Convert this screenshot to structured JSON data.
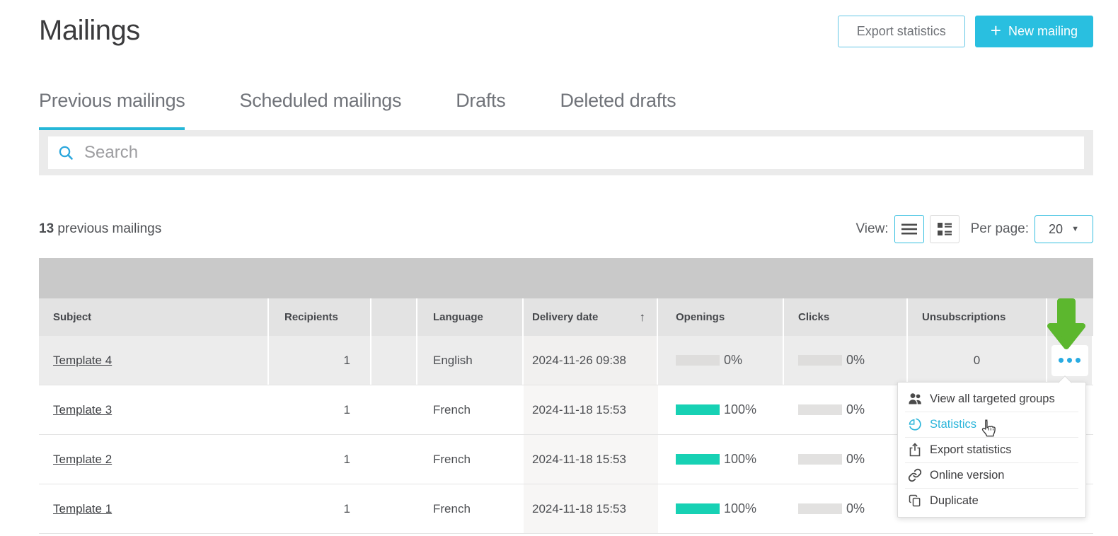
{
  "colors": {
    "accent_cyan": "#29bfe0",
    "tab_underline": "#26b7d8",
    "teal_bar": "#17d1b4",
    "green_arrow": "#5cb72e",
    "icon_blue": "#2ba7dd",
    "menu_hover_blue": "#2cb5da"
  },
  "header": {
    "title": "Mailings",
    "export_button": "Export statistics",
    "new_mailing_plus": "+",
    "new_mailing_button": "New mailing"
  },
  "tabs": [
    {
      "label": "Previous mailings"
    },
    {
      "label": "Scheduled mailings"
    },
    {
      "label": "Drafts"
    },
    {
      "label": "Deleted drafts"
    }
  ],
  "search": {
    "placeholder": "Search"
  },
  "summary": {
    "count": "13",
    "label": "previous mailings"
  },
  "view_controls": {
    "view_label": "View:",
    "per_page_label": "Per page:",
    "per_page_value": "20",
    "per_page_arrow": "▼"
  },
  "table": {
    "columns": {
      "subject": "Subject",
      "recipients": "Recipients",
      "language": "Language",
      "delivery_date": "Delivery date",
      "sort_arrow": "↑",
      "openings": "Openings",
      "clicks": "Clicks",
      "unsubscriptions": "Unsubscriptions"
    },
    "rows": [
      {
        "subject": "Template 4",
        "recipients": "1",
        "language": "English",
        "delivery_date": "2024-11-26 09:38",
        "openings_pct": 0,
        "openings_label": "0%",
        "clicks_pct": 0,
        "clicks_label": "0%",
        "unsubscriptions": "0"
      },
      {
        "subject": "Template 3",
        "recipients": "1",
        "language": "French",
        "delivery_date": "2024-11-18 15:53",
        "openings_pct": 100,
        "openings_label": "100%",
        "clicks_pct": 0,
        "clicks_label": "0%",
        "unsubscriptions": ""
      },
      {
        "subject": "Template 2",
        "recipients": "1",
        "language": "French",
        "delivery_date": "2024-11-18 15:53",
        "openings_pct": 100,
        "openings_label": "100%",
        "clicks_pct": 0,
        "clicks_label": "0%",
        "unsubscriptions": ""
      },
      {
        "subject": "Template 1",
        "recipients": "1",
        "language": "French",
        "delivery_date": "2024-11-18 15:53",
        "openings_pct": 100,
        "openings_label": "100%",
        "clicks_pct": 0,
        "clicks_label": "0%",
        "unsubscriptions": ""
      }
    ]
  },
  "context_menu": {
    "items": [
      {
        "label": "View all targeted groups"
      },
      {
        "label": "Statistics"
      },
      {
        "label": "Export statistics"
      },
      {
        "label": "Online version"
      },
      {
        "label": "Duplicate"
      }
    ]
  }
}
